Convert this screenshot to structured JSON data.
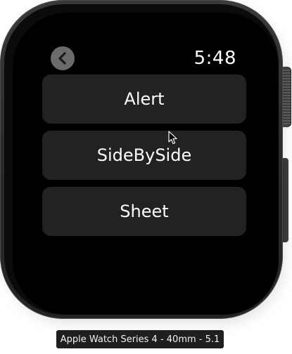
{
  "status_bar": {
    "time": "5:48"
  },
  "navigation": {
    "back_icon": "chevron-left-icon"
  },
  "menu": {
    "items": [
      {
        "label": "Alert"
      },
      {
        "label": "SideBySide"
      },
      {
        "label": "Sheet"
      }
    ]
  },
  "device": {
    "label": "Apple Watch Series 4 - 40mm - 5.1"
  },
  "colors": {
    "screen_background": "#000000",
    "button_background": "#222223",
    "back_button_background": "#6b6b6e",
    "text": "#ffffff"
  }
}
